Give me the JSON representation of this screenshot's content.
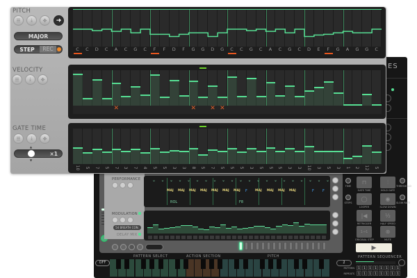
{
  "colors": {
    "accent_green": "#57e094",
    "mute_orange": "#e0602a",
    "panel_bg": "#1e1e1e"
  },
  "front": {
    "pitch": {
      "label": "PITCH",
      "icons": [
        "list-icon",
        "save-icon",
        "dpad-icon",
        "arrow-right-icon"
      ],
      "scale_button": "MAJOR",
      "step_label": "STEP",
      "rec_label": "REC",
      "notes": [
        "C",
        "C",
        "D",
        "C",
        "A",
        "C",
        "G",
        "C",
        "F",
        "F",
        "D",
        "F",
        "G",
        "G",
        "D",
        "G",
        "C",
        "C",
        "G",
        "C",
        "A",
        "C",
        "G",
        "C",
        "D",
        "E",
        "F",
        "G",
        "A",
        "G",
        "G",
        "C"
      ],
      "levels_semitones": [
        0,
        0,
        -2,
        0,
        -3,
        0,
        -5,
        0,
        -7,
        -7,
        -10,
        -7,
        -5,
        -5,
        -10,
        -5,
        0,
        0,
        -2,
        0,
        -3,
        0,
        -5,
        0,
        -10,
        -8,
        -7,
        -5,
        -3,
        -5,
        -5,
        0
      ],
      "marked_steps": [
        1,
        9,
        17,
        27
      ]
    },
    "velocity": {
      "label": "VELOCITY",
      "values_percent": [
        92,
        20,
        75,
        20,
        65,
        27,
        55,
        30,
        90,
        25,
        74,
        29,
        71,
        24,
        57,
        25,
        83,
        27,
        79,
        27,
        67,
        29,
        57,
        27,
        42,
        53,
        69,
        37,
        1,
        1,
        32,
        1
      ],
      "muted_steps": [
        5,
        13,
        15,
        16
      ],
      "mute_symbol": "✕"
    },
    "gate": {
      "label": "GATE TIME",
      "multiplier": "×1",
      "values_percent": [
        47,
        33,
        43,
        35,
        43,
        37,
        43,
        33,
        45,
        35,
        39,
        37,
        45,
        27,
        41,
        37,
        45,
        35,
        45,
        37,
        47,
        37,
        45,
        37,
        51,
        37,
        37,
        37,
        18,
        24,
        53,
        35
      ],
      "step_labels": [
        "10",
        "5",
        "7",
        "5",
        "7",
        "3",
        "7",
        "4",
        "5",
        "5",
        "3",
        "3",
        "8",
        "5",
        "7",
        "5",
        "5",
        "5",
        "3",
        "5",
        "5",
        "5",
        "3",
        "3",
        "10",
        "3",
        "5",
        "3",
        "1",
        "2",
        "12",
        "5"
      ]
    }
  },
  "back": {
    "title_fragment": "ES",
    "performance": {
      "label": "PERFORMANCE",
      "chords": [
        "MAJ",
        "MAJ",
        "MAJ",
        "MAJ",
        "MAJ",
        "MAJ",
        "MAJ",
        "F",
        "MAJ",
        "MAJ",
        "MAJ",
        "MAJ",
        "F",
        "F"
      ],
      "roll_label": "ROL",
      "f_label": "F8"
    },
    "modulation": {
      "label": "MODULATION",
      "source": "54 BREATH CON.",
      "dest": "DELAY MIX",
      "values_percent": [
        30,
        45,
        22,
        26,
        30,
        34,
        40,
        40,
        35,
        22,
        20,
        34,
        30,
        44,
        27,
        33,
        24,
        28,
        30,
        36,
        38,
        30,
        25,
        36,
        44,
        40,
        52,
        38,
        48,
        42,
        44,
        44
      ]
    },
    "active_led": 1,
    "controls": {
      "knobs": [
        "TIME",
        "THRESHOLD",
        "STEPS",
        "SLOW RATE"
      ],
      "buttons": [
        {
          "label": "GATE TIME",
          "glyph": "⊓"
        },
        {
          "label": "HOLD GATE",
          "glyph": "⫶"
        },
        {
          "label": "LOOPER",
          "glyph": "◯"
        },
        {
          "label": "SLOW DOWN",
          "glyph": "◉"
        },
        {
          "label": "RETRIGGER",
          "glyph": "|◀"
        },
        {
          "label": "HALF SPEED",
          "glyph": "½"
        },
        {
          "label": "ORIGINAL STEP",
          "glyph": "1→1"
        },
        {
          "label": "MUTE",
          "glyph": "⊗"
        }
      ],
      "play_icon": "▶"
    },
    "keyboard": {
      "off_button": "OFF",
      "sections": [
        "PATTERN SELECT",
        "ACTION SECTION",
        "PITCH"
      ]
    },
    "pattern_sequencer": {
      "label": "PATTERN SEQUENCER",
      "count": "2",
      "rows": [
        {
          "label": "PATTERN",
          "cells": [
            "1",
            "1",
            "1",
            "1",
            "1",
            "1",
            "1",
            "1"
          ]
        },
        {
          "label": "REPEATS",
          "cells": [
            "1",
            "1",
            "1",
            "1",
            "1",
            "1",
            "1",
            "1"
          ]
        }
      ]
    }
  }
}
